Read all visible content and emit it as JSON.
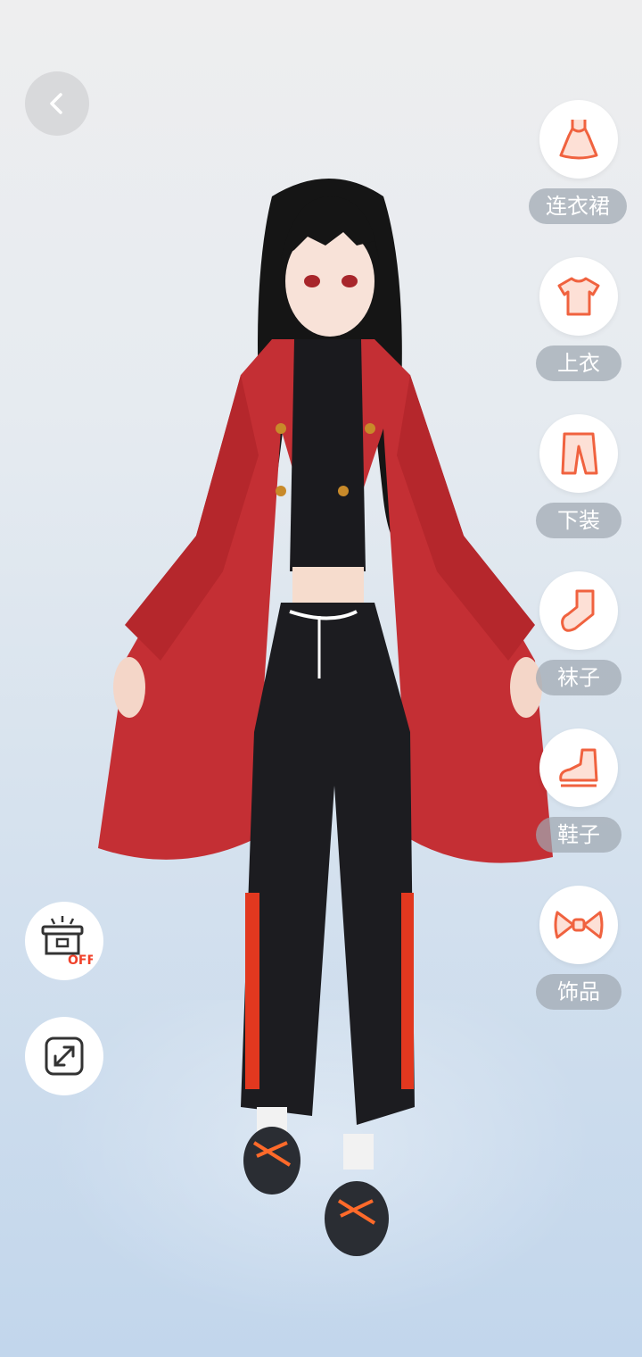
{
  "back_button": {
    "icon": "chevron-left-icon"
  },
  "menu": [
    {
      "id": "dress",
      "label": "连衣裙",
      "icon": "dress-icon"
    },
    {
      "id": "top",
      "label": "上衣",
      "icon": "tshirt-icon"
    },
    {
      "id": "bottom",
      "label": "下装",
      "icon": "pants-icon"
    },
    {
      "id": "socks",
      "label": "袜子",
      "icon": "sock-icon"
    },
    {
      "id": "shoes",
      "label": "鞋子",
      "icon": "shoe-icon"
    },
    {
      "id": "accessory",
      "label": "饰品",
      "icon": "bow-icon"
    }
  ],
  "stage_toggle": {
    "state": "OFF",
    "icon": "stage-light-icon"
  },
  "fullscreen_button": {
    "icon": "expand-icon"
  },
  "colors": {
    "accent": "#f0623f",
    "icon_fill": "#fde0d6",
    "label_bg": "#a0a8b2"
  }
}
